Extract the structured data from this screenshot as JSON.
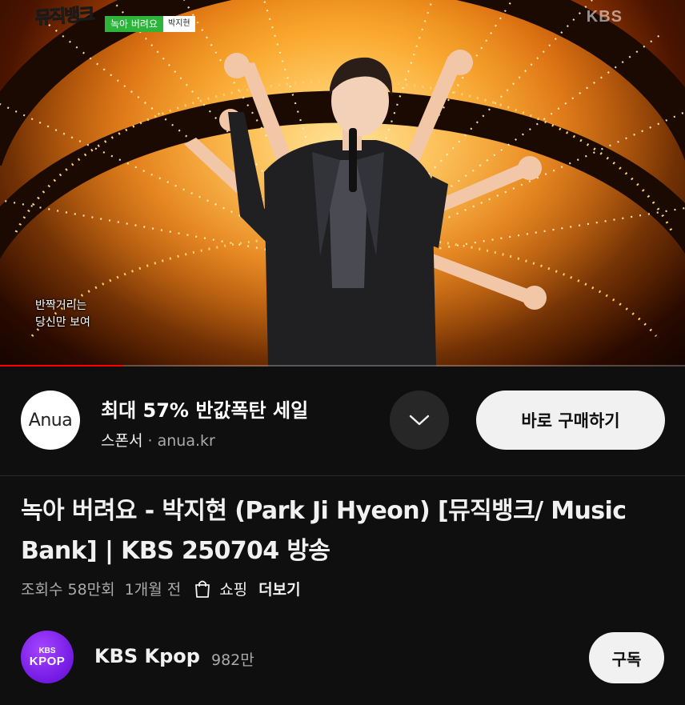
{
  "video": {
    "show_logo": "뮤직뱅크",
    "song_tag": {
      "title": "녹아 버려요",
      "artist": "박지현"
    },
    "watermark": "KBS",
    "lyrics": [
      "반짝거리는",
      "당신만 보여"
    ],
    "progress": 0.18
  },
  "sponsor": {
    "logo_text": "Anua",
    "title": "최대 57% 반값폭탄 세일",
    "label": "스폰서",
    "separator": "·",
    "domain": "anua.kr",
    "cta_label": "바로 구매하기",
    "expand_icon": "chevron-down-icon"
  },
  "video_info": {
    "title": "녹아 버려요 - 박지현 (Park Ji Hyeon) [뮤직뱅크/ Music Bank] | KBS 250704 방송",
    "views": "조회수 58만회",
    "age": "1개월 전",
    "shopping_icon": "shopping-bag-icon",
    "shopping_label": "쇼핑",
    "more_label": "더보기"
  },
  "channel": {
    "avatar_line1": "KBS",
    "avatar_line2": "KPOP",
    "name": "KBS Kpop",
    "subscribers": "982만",
    "subscribe_label": "구독"
  },
  "colors": {
    "background": "#0f0f0f",
    "progress": "#ff0000",
    "avatar": "#7a1fe8",
    "song_tag": "#2cb53a"
  }
}
